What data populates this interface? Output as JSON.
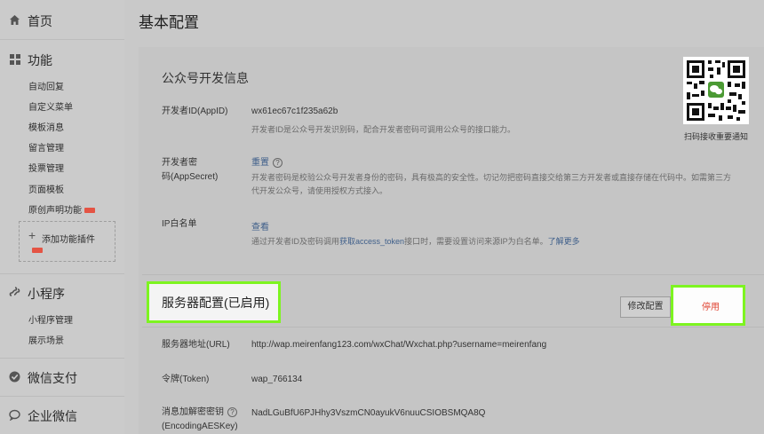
{
  "sidebar": {
    "home": "首页",
    "functions": {
      "title": "功能",
      "items": [
        "自动回复",
        "自定义菜单",
        "模板消息",
        "留言管理",
        "投票管理",
        "页面模板",
        "原创声明功能"
      ],
      "add_plugin": "添加功能插件"
    },
    "mini_program": {
      "title": "小程序",
      "items": [
        "小程序管理",
        "展示场景"
      ]
    },
    "wechat_pay": "微信支付",
    "work_wechat": "企业微信"
  },
  "page_title": "基本配置",
  "dev_info": {
    "title": "公众号开发信息",
    "appid_label": "开发者ID(AppID)",
    "appid_value": "wx61ec67c1f235a62b",
    "appid_desc": "开发者ID是公众号开发识别码，配合开发者密码可调用公众号的接口能力。",
    "secret_label_1": "开发者密",
    "secret_label_2": "码(AppSecret)",
    "secret_action": "重置",
    "secret_desc": "开发者密码是校验公众号开发者身份的密码，具有极高的安全性。切记勿把密码直接交给第三方开发者或直接存储在代码中。如需第三方代开发公众号，请使用授权方式接入。",
    "ip_label": "IP白名单",
    "ip_action": "查看",
    "ip_desc_1": "通过开发者ID及密码调用",
    "ip_desc_link": "获取access_token",
    "ip_desc_2": "接口时，需要设置访问来源IP为白名单。",
    "ip_learn_more": "了解更多"
  },
  "qr": {
    "caption": "扫码接收重要通知"
  },
  "server": {
    "title": "服务器配置(已启用)",
    "modify_button": "修改配置",
    "disable_button": "停用",
    "url_label": "服务器地址(URL)",
    "url_value": "http://wap.meirenfang123.com/wxChat/Wxchat.php?username=meirenfang",
    "token_label": "令牌(Token)",
    "token_value": "wap_766134",
    "aes_label_1": "消息加解密密钥",
    "aes_label_2": "(EncodingAESKey)",
    "aes_value": "NadLGuBfU6PJHhy3VszmCN0ayukV6nuuCSIOBSMQA8Q"
  },
  "colors": {
    "highlight": "#7df420",
    "danger": "#e0402e",
    "link": "#3f5f8a"
  }
}
